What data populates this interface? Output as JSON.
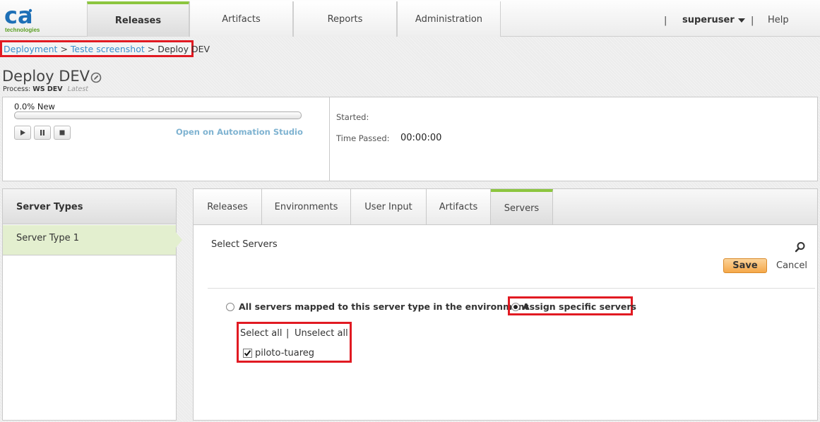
{
  "header": {
    "logo_text": "ca",
    "logo_subtext": "technologies",
    "tabs": [
      {
        "label": "Releases",
        "active": true
      },
      {
        "label": "Artifacts",
        "active": false
      },
      {
        "label": "Reports",
        "active": false
      },
      {
        "label": "Administration",
        "active": false
      }
    ],
    "separator": "|",
    "username": "superuser",
    "help_label": "Help"
  },
  "breadcrumb": {
    "items": [
      "Deployment",
      "Teste screenshot",
      "Deploy DEV"
    ],
    "separator": ">"
  },
  "page": {
    "title": "Deploy DEV",
    "process_label": "Process:",
    "process_name": "WS DEV",
    "process_version": "Latest"
  },
  "status": {
    "progress_text": "0.0% New",
    "progress_fraction": 0.0,
    "open_studio_label": "Open on Automation Studio",
    "started_label": "Started:",
    "started_value": "",
    "time_passed_label": "Time Passed:",
    "time_passed_value": "00:00:00"
  },
  "server_types": {
    "header": "Server Types",
    "items": [
      "Server Type 1"
    ]
  },
  "subtabs": [
    {
      "label": "Releases",
      "active": false
    },
    {
      "label": "Environments",
      "active": false
    },
    {
      "label": "User Input",
      "active": false
    },
    {
      "label": "Artifacts",
      "active": false
    },
    {
      "label": "Servers",
      "active": true
    }
  ],
  "servers": {
    "title": "Select Servers",
    "save_label": "Save",
    "cancel_label": "Cancel",
    "option_all_label": "All servers mapped to this server type in the environment",
    "option_specific_label": "Assign specific servers",
    "selected_option": "specific",
    "select_all_label": "Select all",
    "pipe": "|",
    "unselect_all_label": "Unselect all",
    "list": [
      {
        "name": "piloto-tuareg",
        "checked": true
      }
    ]
  },
  "colors": {
    "accent_green": "#8cc63f",
    "highlight_red": "#e11a22",
    "link_blue": "#3a8fce",
    "save_orange": "#f5a84a"
  },
  "icons": [
    "edit-icon",
    "play-icon",
    "pause-icon",
    "stop-icon",
    "search-icon",
    "chevron-down-icon"
  ]
}
